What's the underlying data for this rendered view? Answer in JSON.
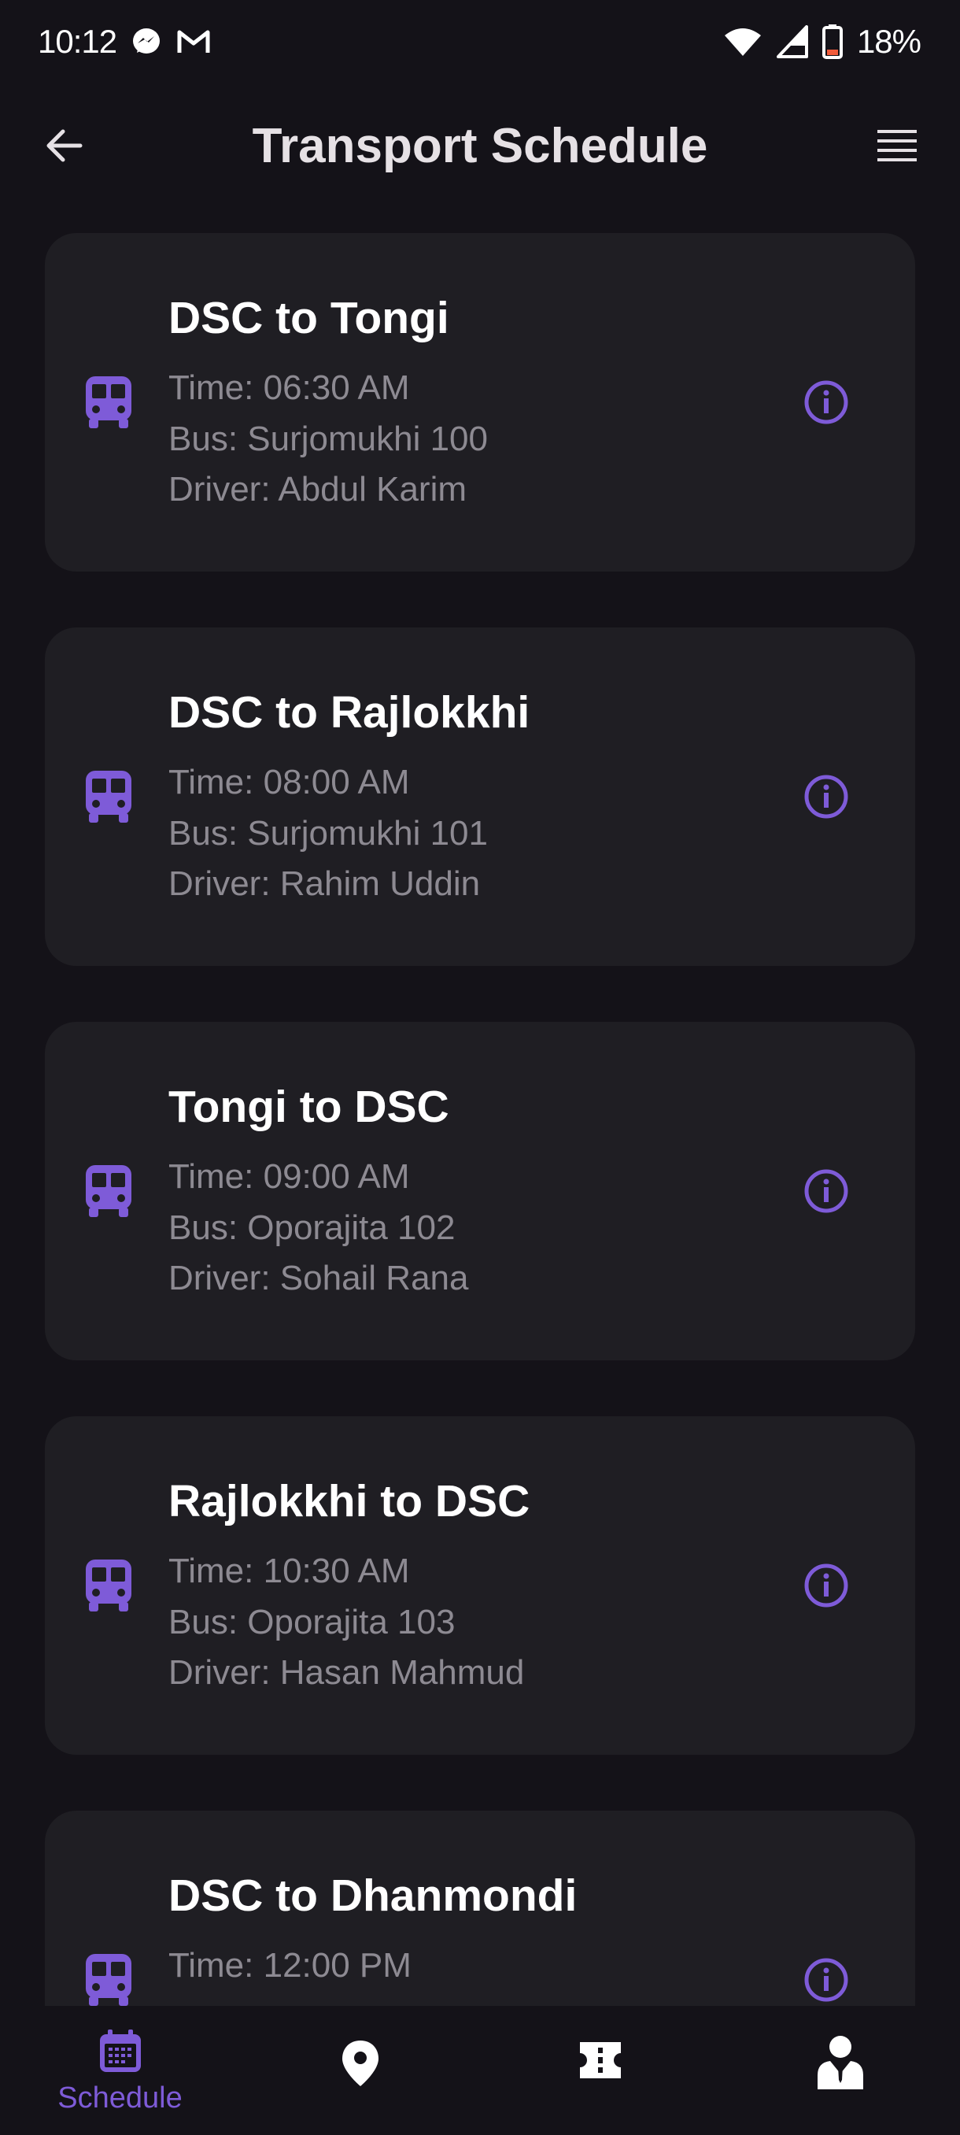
{
  "status_bar": {
    "time": "10:12",
    "battery": "18%",
    "icons": [
      "messenger-icon",
      "gmail-icon",
      "wifi-icon",
      "signal-icon",
      "battery-icon"
    ]
  },
  "app_bar": {
    "title": "Transport Schedule",
    "back_icon": "arrow-back-icon",
    "menu_icon": "menu-icon"
  },
  "schedules": [
    {
      "route": "DSC to Tongi",
      "time": "Time: 06:30 AM",
      "bus": "Bus: Surjomukhi 100",
      "driver": "Driver: Abdul Karim"
    },
    {
      "route": "DSC to Rajlokkhi",
      "time": "Time: 08:00 AM",
      "bus": "Bus: Surjomukhi 101",
      "driver": "Driver: Rahim Uddin"
    },
    {
      "route": "Tongi to DSC",
      "time": "Time: 09:00 AM",
      "bus": "Bus: Oporajita 102",
      "driver": "Driver: Sohail Rana"
    },
    {
      "route": "Rajlokkhi to DSC",
      "time": "Time: 10:30 AM",
      "bus": "Bus: Oporajita 103",
      "driver": "Driver: Hasan Mahmud"
    },
    {
      "route": "DSC to Dhanmondi",
      "time": "Time: 12:00 PM"
    }
  ],
  "bottom_nav": {
    "items": [
      {
        "label": "Schedule",
        "icon": "calendar-icon",
        "selected": true
      },
      {
        "icon": "location-pin-icon"
      },
      {
        "icon": "ticket-icon"
      },
      {
        "icon": "person-icon"
      }
    ]
  },
  "colors": {
    "background": "#141218",
    "card": "#1f1e23",
    "accent": "#7e5bd8",
    "secondary_text": "#8d8a92"
  }
}
